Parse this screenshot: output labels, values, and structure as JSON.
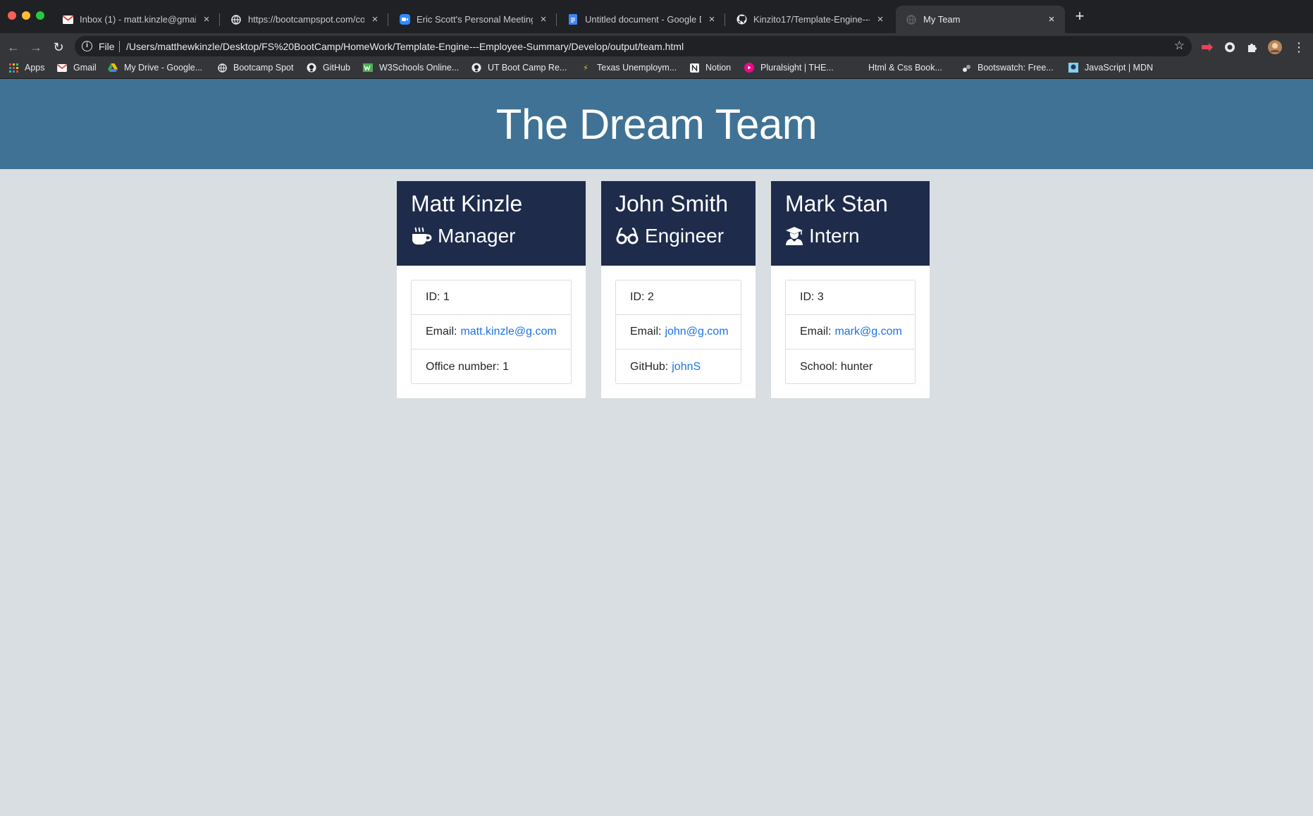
{
  "browser": {
    "tabs": [
      {
        "title": "Inbox (1) - matt.kinzle@gmail.c",
        "icon": "gmail-icon",
        "active": false
      },
      {
        "title": "https://bootcampspot.com/cou",
        "icon": "globe-icon",
        "active": false
      },
      {
        "title": "Eric Scott's Personal Meeting R",
        "icon": "zoom-icon",
        "active": false
      },
      {
        "title": "Untitled document - Google Do",
        "icon": "google-docs-icon",
        "active": false
      },
      {
        "title": "Kinzito17/Template-Engine---E",
        "icon": "github-icon",
        "active": false
      },
      {
        "title": "My Team",
        "icon": "globe-icon",
        "active": true
      }
    ],
    "address_bar": {
      "scheme_label": "File",
      "url": "/Users/matthewkinzle/Desktop/FS%20BootCamp/HomeWork/Template-Engine---Employee-Summary/Develop/output/team.html"
    },
    "bookmarks": [
      {
        "label": "Apps",
        "icon": "apps-grid-icon"
      },
      {
        "label": "Gmail",
        "icon": "gmail-icon"
      },
      {
        "label": "My Drive - Google...",
        "icon": "google-drive-icon"
      },
      {
        "label": "Bootcamp Spot",
        "icon": "globe-icon"
      },
      {
        "label": "GitHub",
        "icon": "github-icon"
      },
      {
        "label": "W3Schools Online...",
        "icon": "w3schools-icon"
      },
      {
        "label": "UT Boot Camp Re...",
        "icon": "github-icon"
      },
      {
        "label": "Texas Unemploym...",
        "icon": "lightning-icon"
      },
      {
        "label": "Notion",
        "icon": "notion-icon"
      },
      {
        "label": "Pluralsight | THE...",
        "icon": "pluralsight-icon"
      },
      {
        "label": "Html & Css Book...",
        "icon": "bookmark-icon"
      },
      {
        "label": "Bootswatch: Free...",
        "icon": "bootswatch-icon"
      },
      {
        "label": "JavaScript | MDN",
        "icon": "mdn-icon"
      }
    ]
  },
  "page": {
    "title": "The Dream Team",
    "colors": {
      "jumbotron": "#3f7295",
      "card_header": "#1e2b4b",
      "background": "#d9dee2",
      "link": "#1a73e8"
    },
    "employees": [
      {
        "name": "Matt Kinzle",
        "role": "Manager",
        "role_icon": "coffee-mug-icon",
        "id_text": "ID: 1",
        "email_label": "Email:",
        "email": "matt.kinzle@g.com",
        "extra_label": "Office number: 1",
        "extra_value": ""
      },
      {
        "name": "John Smith",
        "role": "Engineer",
        "role_icon": "glasses-icon",
        "id_text": "ID: 2",
        "email_label": "Email:",
        "email": "john@g.com",
        "extra_label": "GitHub:",
        "extra_value": "johnS"
      },
      {
        "name": "Mark Stan",
        "role": "Intern",
        "role_icon": "graduate-icon",
        "id_text": "ID: 3",
        "email_label": "Email:",
        "email": "mark@g.com",
        "extra_label": "School: hunter",
        "extra_value": ""
      }
    ]
  }
}
